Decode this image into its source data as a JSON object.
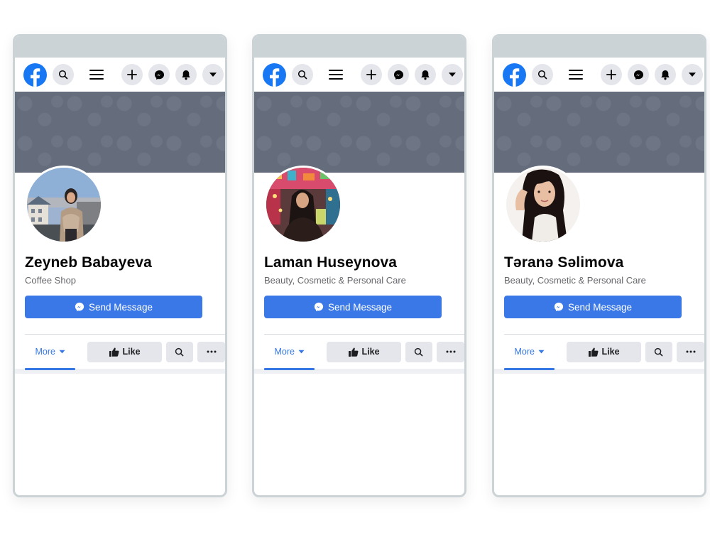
{
  "profiles": [
    {
      "name": "Zeyneb Babayeva",
      "category": "Coffee Shop",
      "send_label": "Send Message",
      "more_label": "More",
      "like_label": "Like"
    },
    {
      "name": "Laman Huseynova",
      "category": "Beauty, Cosmetic & Personal Care",
      "send_label": "Send Message",
      "more_label": "More",
      "like_label": "Like"
    },
    {
      "name": "Təranə Səlimova",
      "category": "Beauty, Cosmetic & Personal Care",
      "send_label": "Send Message",
      "more_label": "More",
      "like_label": "Like"
    }
  ],
  "icons": {
    "logo": "facebook-logo-icon",
    "search": "search-icon",
    "menu": "hamburger-menu-icon",
    "create": "plus-icon",
    "messenger": "messenger-icon",
    "notifications": "bell-icon",
    "account": "caret-down-icon",
    "like": "thumbs-up-icon",
    "overflow": "ellipsis-icon"
  },
  "colors": {
    "facebook_blue": "#1877f2",
    "button_blue": "#3a78e8",
    "tab_blue": "#3578e5",
    "cover_gray": "#656d7d",
    "frame_gray": "#ccd3d6"
  }
}
